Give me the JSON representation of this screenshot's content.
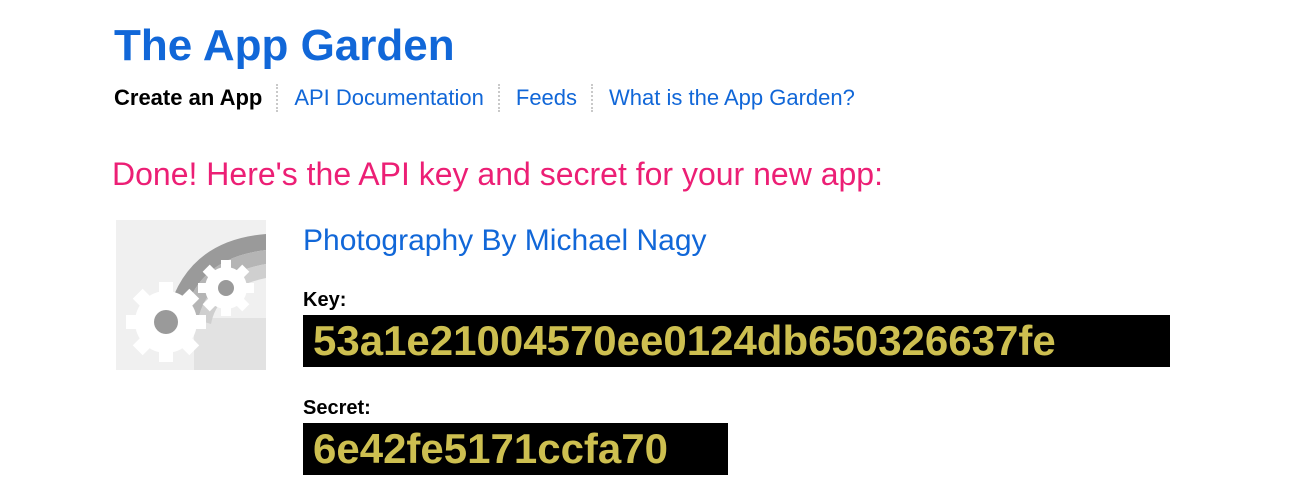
{
  "header": {
    "title": "The App Garden"
  },
  "subnav": {
    "items": [
      {
        "label": "Create an App",
        "current": true
      },
      {
        "label": "API Documentation",
        "current": false
      },
      {
        "label": "Feeds",
        "current": false
      },
      {
        "label": "What is the App Garden?",
        "current": false
      }
    ]
  },
  "result": {
    "headline": "Done! Here's the API key and secret for your new app:",
    "app_icon": "app-gears-icon",
    "app_name": "Photography By Michael Nagy",
    "key_label": "Key:",
    "key_value": "53a1e21004570ee0124db650326637fe",
    "secret_label": "Secret:",
    "secret_value": "6e42fe5171ccfa70"
  },
  "colors": {
    "link": "#1167d8",
    "headline": "#ec1f75",
    "token_background": "#000000",
    "token_text": "#cdbf50"
  }
}
